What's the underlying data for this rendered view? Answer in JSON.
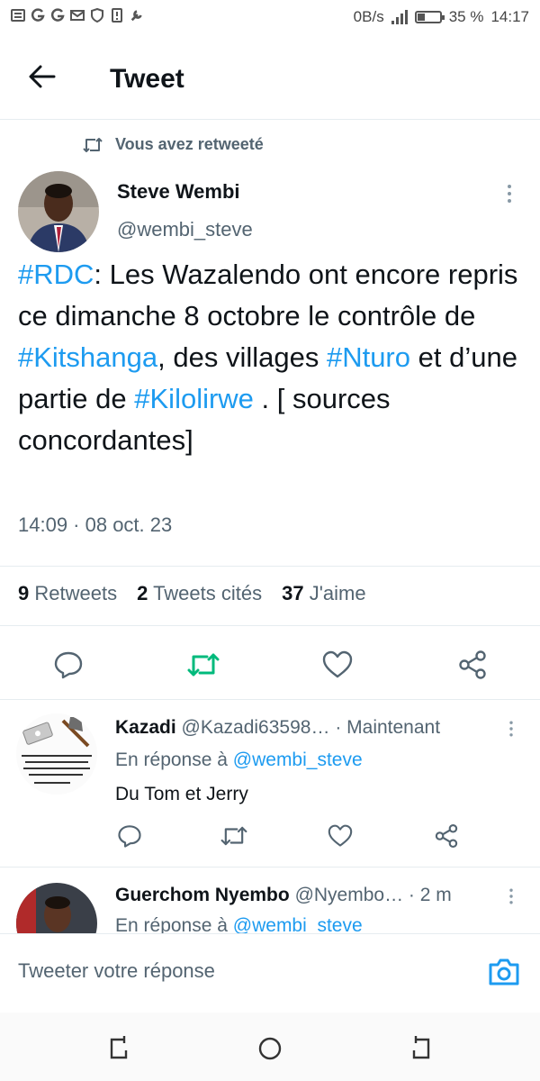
{
  "status_bar": {
    "network_speed": "0B/s",
    "battery_percent": "35 %",
    "time": "14:17",
    "battery_level": 0.35,
    "left_icons": [
      "newspaper-icon",
      "g-icon",
      "google-icon",
      "mail-icon",
      "shield-icon",
      "sim-icon",
      "wrench-icon"
    ]
  },
  "header": {
    "title": "Tweet"
  },
  "tweet": {
    "retweet_label": "Vous avez retweeté",
    "author_name": "Steve Wembi",
    "author_handle": "@wembi_steve",
    "text": [
      {
        "t": "#RDC",
        "tag": true
      },
      {
        "t": ": Les Wazalendo ont encore repris ce dimanche 8 octobre le contrôle de ",
        "tag": false
      },
      {
        "t": "#Kitshanga",
        "tag": true
      },
      {
        "t": ", des villages ",
        "tag": false
      },
      {
        "t": "#Nturo",
        "tag": true
      },
      {
        "t": " et d’une partie de ",
        "tag": false
      },
      {
        "t": "#Kilolirwe",
        "tag": true
      },
      {
        "t": " . [ sources concordantes]",
        "tag": false
      }
    ],
    "timestamp": "14:09 · 08 oct. 23",
    "stats": {
      "retweets_count": "9",
      "retweets_label": "Retweets",
      "quotes_count": "2",
      "quotes_label": "Tweets cités",
      "likes_count": "37",
      "likes_label": "J'aime"
    }
  },
  "replies": [
    {
      "name": "Kazadi",
      "handle": "@Kazadi63598…",
      "time": "· Maintenant",
      "reply_prefix": "En réponse à",
      "reply_to": "@wembi_steve",
      "text": "Du Tom et Jerry"
    },
    {
      "name": "Guerchom Nyembo",
      "handle": "@Nyembo…",
      "time": "· 2 m",
      "reply_prefix": "En réponse à",
      "reply_to": "@wembi_steve",
      "text": ""
    }
  ],
  "composer": {
    "placeholder": "Tweeter votre réponse"
  },
  "colors": {
    "accent": "#1d9bf0",
    "retweet_green": "#00ba7c",
    "muted": "#536471"
  }
}
